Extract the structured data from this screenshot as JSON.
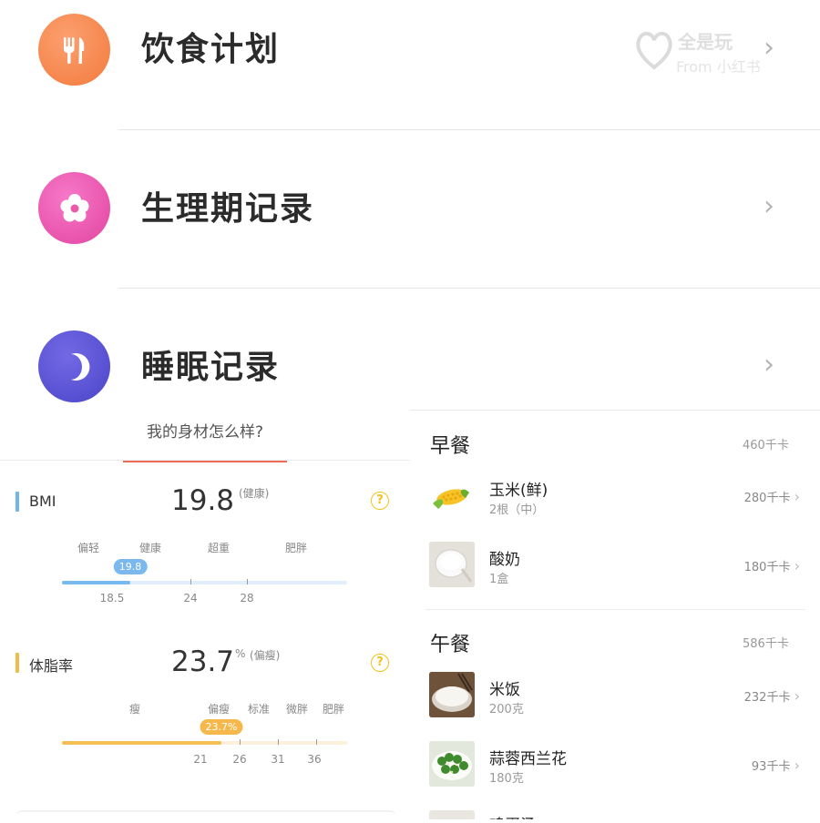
{
  "menu": {
    "items": [
      {
        "label": "饮食计划",
        "icon": "fork-knife-icon",
        "color": "#f5884f"
      },
      {
        "label": "生理期记录",
        "icon": "flower-icon",
        "color": "#e94fb4"
      },
      {
        "label": "睡眠记录",
        "icon": "moon-icon",
        "color": "#6055d8"
      }
    ],
    "watermark": {
      "line1": "全是玩",
      "line2": "From 小红书"
    }
  },
  "body_panel": {
    "tab_label": "我的身材怎么样?",
    "bmi": {
      "name": "BMI",
      "value": "19.8",
      "unit": "",
      "status": "(健康)",
      "accent_color": "#6fb6ec",
      "categories": [
        "偏轻",
        "健康",
        "超重",
        "肥胖"
      ],
      "ticks": [
        "18.5",
        "24",
        "28"
      ],
      "bubble": "19.8",
      "fill_fraction": 0.24
    },
    "body_fat": {
      "name": "体脂率",
      "value": "23.7",
      "unit": "%",
      "status": "(偏瘦)",
      "accent_color": "#f5b94a",
      "categories": [
        "瘦",
        "偏瘦",
        "标准",
        "微胖",
        "肥胖"
      ],
      "ticks": [
        "21",
        "26",
        "31",
        "36"
      ],
      "bubble": "23.7%",
      "fill_fraction": 0.56
    }
  },
  "meals": {
    "breakfast": {
      "title": "早餐",
      "total": "460千卡",
      "foods": [
        {
          "name": "玉米(鲜)",
          "amount": "2根（中）",
          "kcal": "280千卡",
          "icon": "corn-icon"
        },
        {
          "name": "酸奶",
          "amount": "1盒",
          "kcal": "180千卡",
          "icon": "yogurt-icon"
        }
      ]
    },
    "lunch": {
      "title": "午餐",
      "total": "586千卡",
      "foods": [
        {
          "name": "米饭",
          "amount": "200克",
          "kcal": "232千卡",
          "icon": "rice-icon"
        },
        {
          "name": "蒜蓉西兰花",
          "amount": "180克",
          "kcal": "93千卡",
          "icon": "broccoli-icon"
        },
        {
          "name": "鸡蛋汤",
          "amount": "",
          "kcal": "",
          "icon": "soup-icon"
        }
      ]
    }
  }
}
